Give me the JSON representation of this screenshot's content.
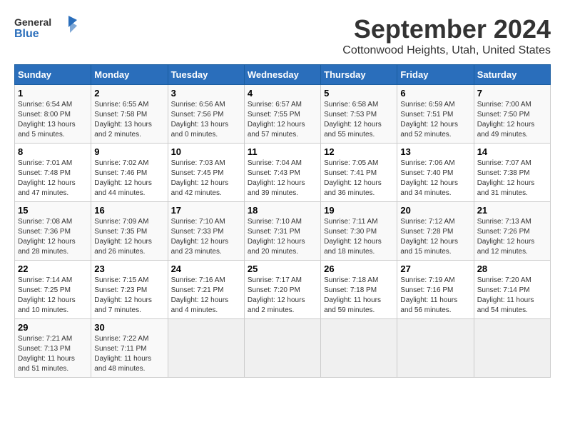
{
  "header": {
    "logo_line1": "General",
    "logo_line2": "Blue",
    "title": "September 2024",
    "subtitle": "Cottonwood Heights, Utah, United States"
  },
  "weekdays": [
    "Sunday",
    "Monday",
    "Tuesday",
    "Wednesday",
    "Thursday",
    "Friday",
    "Saturday"
  ],
  "weeks": [
    [
      {
        "day": "1",
        "info": "Sunrise: 6:54 AM\nSunset: 8:00 PM\nDaylight: 13 hours and 5 minutes."
      },
      {
        "day": "2",
        "info": "Sunrise: 6:55 AM\nSunset: 7:58 PM\nDaylight: 13 hours and 2 minutes."
      },
      {
        "day": "3",
        "info": "Sunrise: 6:56 AM\nSunset: 7:56 PM\nDaylight: 13 hours and 0 minutes."
      },
      {
        "day": "4",
        "info": "Sunrise: 6:57 AM\nSunset: 7:55 PM\nDaylight: 12 hours and 57 minutes."
      },
      {
        "day": "5",
        "info": "Sunrise: 6:58 AM\nSunset: 7:53 PM\nDaylight: 12 hours and 55 minutes."
      },
      {
        "day": "6",
        "info": "Sunrise: 6:59 AM\nSunset: 7:51 PM\nDaylight: 12 hours and 52 minutes."
      },
      {
        "day": "7",
        "info": "Sunrise: 7:00 AM\nSunset: 7:50 PM\nDaylight: 12 hours and 49 minutes."
      }
    ],
    [
      {
        "day": "8",
        "info": "Sunrise: 7:01 AM\nSunset: 7:48 PM\nDaylight: 12 hours and 47 minutes."
      },
      {
        "day": "9",
        "info": "Sunrise: 7:02 AM\nSunset: 7:46 PM\nDaylight: 12 hours and 44 minutes."
      },
      {
        "day": "10",
        "info": "Sunrise: 7:03 AM\nSunset: 7:45 PM\nDaylight: 12 hours and 42 minutes."
      },
      {
        "day": "11",
        "info": "Sunrise: 7:04 AM\nSunset: 7:43 PM\nDaylight: 12 hours and 39 minutes."
      },
      {
        "day": "12",
        "info": "Sunrise: 7:05 AM\nSunset: 7:41 PM\nDaylight: 12 hours and 36 minutes."
      },
      {
        "day": "13",
        "info": "Sunrise: 7:06 AM\nSunset: 7:40 PM\nDaylight: 12 hours and 34 minutes."
      },
      {
        "day": "14",
        "info": "Sunrise: 7:07 AM\nSunset: 7:38 PM\nDaylight: 12 hours and 31 minutes."
      }
    ],
    [
      {
        "day": "15",
        "info": "Sunrise: 7:08 AM\nSunset: 7:36 PM\nDaylight: 12 hours and 28 minutes."
      },
      {
        "day": "16",
        "info": "Sunrise: 7:09 AM\nSunset: 7:35 PM\nDaylight: 12 hours and 26 minutes."
      },
      {
        "day": "17",
        "info": "Sunrise: 7:10 AM\nSunset: 7:33 PM\nDaylight: 12 hours and 23 minutes."
      },
      {
        "day": "18",
        "info": "Sunrise: 7:10 AM\nSunset: 7:31 PM\nDaylight: 12 hours and 20 minutes."
      },
      {
        "day": "19",
        "info": "Sunrise: 7:11 AM\nSunset: 7:30 PM\nDaylight: 12 hours and 18 minutes."
      },
      {
        "day": "20",
        "info": "Sunrise: 7:12 AM\nSunset: 7:28 PM\nDaylight: 12 hours and 15 minutes."
      },
      {
        "day": "21",
        "info": "Sunrise: 7:13 AM\nSunset: 7:26 PM\nDaylight: 12 hours and 12 minutes."
      }
    ],
    [
      {
        "day": "22",
        "info": "Sunrise: 7:14 AM\nSunset: 7:25 PM\nDaylight: 12 hours and 10 minutes."
      },
      {
        "day": "23",
        "info": "Sunrise: 7:15 AM\nSunset: 7:23 PM\nDaylight: 12 hours and 7 minutes."
      },
      {
        "day": "24",
        "info": "Sunrise: 7:16 AM\nSunset: 7:21 PM\nDaylight: 12 hours and 4 minutes."
      },
      {
        "day": "25",
        "info": "Sunrise: 7:17 AM\nSunset: 7:20 PM\nDaylight: 12 hours and 2 minutes."
      },
      {
        "day": "26",
        "info": "Sunrise: 7:18 AM\nSunset: 7:18 PM\nDaylight: 11 hours and 59 minutes."
      },
      {
        "day": "27",
        "info": "Sunrise: 7:19 AM\nSunset: 7:16 PM\nDaylight: 11 hours and 56 minutes."
      },
      {
        "day": "28",
        "info": "Sunrise: 7:20 AM\nSunset: 7:14 PM\nDaylight: 11 hours and 54 minutes."
      }
    ],
    [
      {
        "day": "29",
        "info": "Sunrise: 7:21 AM\nSunset: 7:13 PM\nDaylight: 11 hours and 51 minutes."
      },
      {
        "day": "30",
        "info": "Sunrise: 7:22 AM\nSunset: 7:11 PM\nDaylight: 11 hours and 48 minutes."
      },
      null,
      null,
      null,
      null,
      null
    ]
  ]
}
